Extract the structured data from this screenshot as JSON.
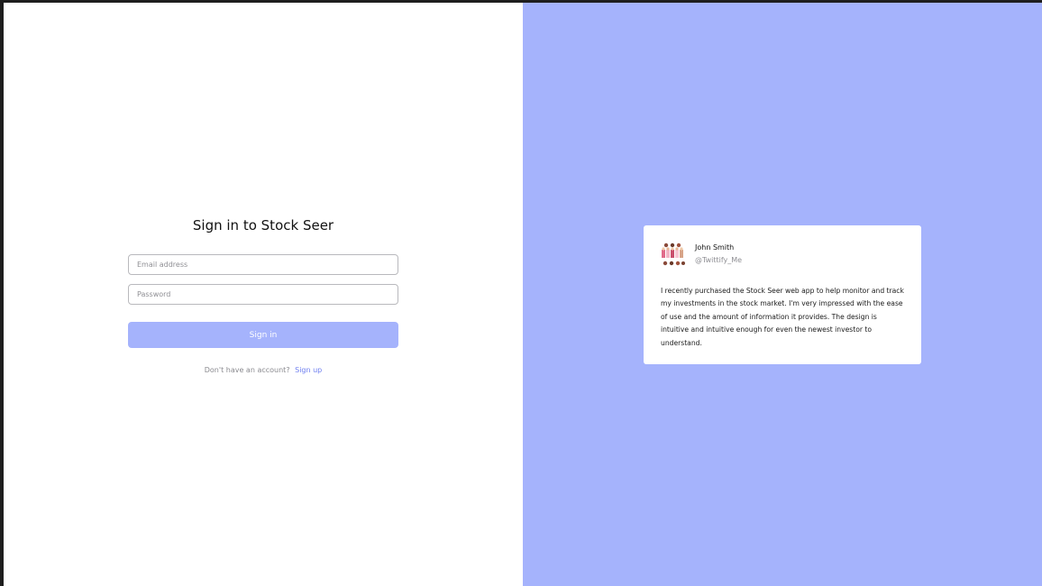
{
  "signin": {
    "title": "Sign in to Stock Seer",
    "email_placeholder": "Email address",
    "password_placeholder": "Password",
    "submit_label": "Sign in",
    "no_account_text": "Don't have an account?",
    "signup_link": "Sign up"
  },
  "testimonial": {
    "name": "John Smith",
    "handle": "@Twittify_Me",
    "quote": "I recently purchased the Stock Seer web app to help monitor and track my investments in the stock market. I'm very impressed with the ease of use and the amount of information it provides. The design is intuitive and intuitive enough for even the newest investor to understand.",
    "avatar_icon": "avatar-group-icon"
  },
  "colors": {
    "accent": "#a5b3fc",
    "link": "#6f7ff0",
    "background": "#ffffff"
  }
}
